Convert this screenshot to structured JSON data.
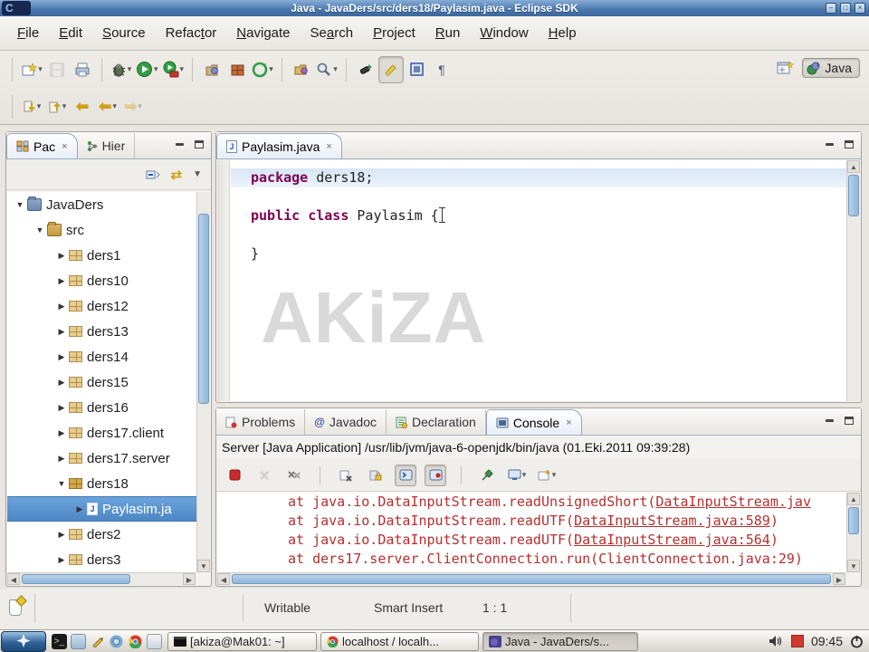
{
  "window": {
    "title": "Java - JavaDers/src/ders18/Paylasim.java - Eclipse SDK",
    "icon_label": "C"
  },
  "glyphs": {
    "chevron": "▾",
    "close": "×",
    "up": "▲",
    "down": "▼",
    "left": "◀",
    "right": "▶",
    "paragraph": "¶",
    "at": "@",
    "link_editor": "⇄",
    "view_menu": "▼",
    "back_arrow": "⬅",
    "fwd_arrow": "➡"
  },
  "menu": {
    "items": [
      {
        "pre": "",
        "key": "F",
        "post": "ile"
      },
      {
        "pre": "",
        "key": "E",
        "post": "dit"
      },
      {
        "pre": "",
        "key": "S",
        "post": "ource"
      },
      {
        "pre": "Refac",
        "key": "t",
        "post": "or"
      },
      {
        "pre": "",
        "key": "N",
        "post": "avigate"
      },
      {
        "pre": "Se",
        "key": "a",
        "post": "rch"
      },
      {
        "pre": "",
        "key": "P",
        "post": "roject"
      },
      {
        "pre": "",
        "key": "R",
        "post": "un"
      },
      {
        "pre": "",
        "key": "W",
        "post": "indow"
      },
      {
        "pre": "",
        "key": "H",
        "post": "elp"
      }
    ]
  },
  "perspective": {
    "java_label": "Java"
  },
  "explorer": {
    "tab_package": "Pac",
    "tab_hierarchy": "Hier",
    "tree": [
      {
        "arrow": "▼",
        "label": "JavaDers"
      },
      {
        "arrow": "▼",
        "label": "src"
      },
      {
        "arrow": "▶",
        "label": "ders1"
      },
      {
        "arrow": "▶",
        "label": "ders10"
      },
      {
        "arrow": "▶",
        "label": "ders12"
      },
      {
        "arrow": "▶",
        "label": "ders13"
      },
      {
        "arrow": "▶",
        "label": "ders14"
      },
      {
        "arrow": "▶",
        "label": "ders15"
      },
      {
        "arrow": "▶",
        "label": "ders16"
      },
      {
        "arrow": "▶",
        "label": "ders17.client"
      },
      {
        "arrow": "▶",
        "label": "ders17.server"
      },
      {
        "arrow": "▼",
        "label": "ders18"
      },
      {
        "arrow": "▶",
        "label": "Paylasim.ja"
      },
      {
        "arrow": "▶",
        "label": "ders2"
      },
      {
        "arrow": "▶",
        "label": "ders3"
      }
    ]
  },
  "editor": {
    "tab_label": "Paylasim.java",
    "watermark": "AKiZA",
    "code": [
      {
        "keyword": "package",
        "rest": " ders18;"
      },
      {
        "keyword": "",
        "rest": ""
      },
      {
        "keyword": "public class",
        "rest": " Paylasim {"
      },
      {
        "keyword": "",
        "rest": ""
      },
      {
        "keyword": "",
        "rest": "}"
      }
    ]
  },
  "console": {
    "tabs": {
      "problems": "Problems",
      "javadoc": "Javadoc",
      "declaration": "Declaration",
      "console": "Console"
    },
    "header": "Server [Java Application] /usr/lib/jvm/java-6-openjdk/bin/java (01.Eki.2011 09:39:28)",
    "trace": [
      {
        "pre": "at java.io.DataInputStream.readUnsignedShort(",
        "link": "DataInputStream.jav",
        "post": ""
      },
      {
        "pre": "at java.io.DataInputStream.readUTF(",
        "link": "DataInputStream.java:589",
        "post": ")"
      },
      {
        "pre": "at java.io.DataInputStream.readUTF(",
        "link": "DataInputStream.java:564",
        "post": ")"
      },
      {
        "pre": "at ders17.server.ClientConnection.run(ClientConnection.java:29)",
        "link": "",
        "post": ""
      }
    ]
  },
  "statusbar": {
    "writable": "Writable",
    "smart_insert": "Smart Insert",
    "position": "1 : 1"
  },
  "taskbar": {
    "windows": [
      {
        "label": "[akiza@Mak01: ~]"
      },
      {
        "label": "localhost / localh..."
      },
      {
        "label": "Java - JavaDers/s..."
      }
    ],
    "clock": "09:45"
  }
}
